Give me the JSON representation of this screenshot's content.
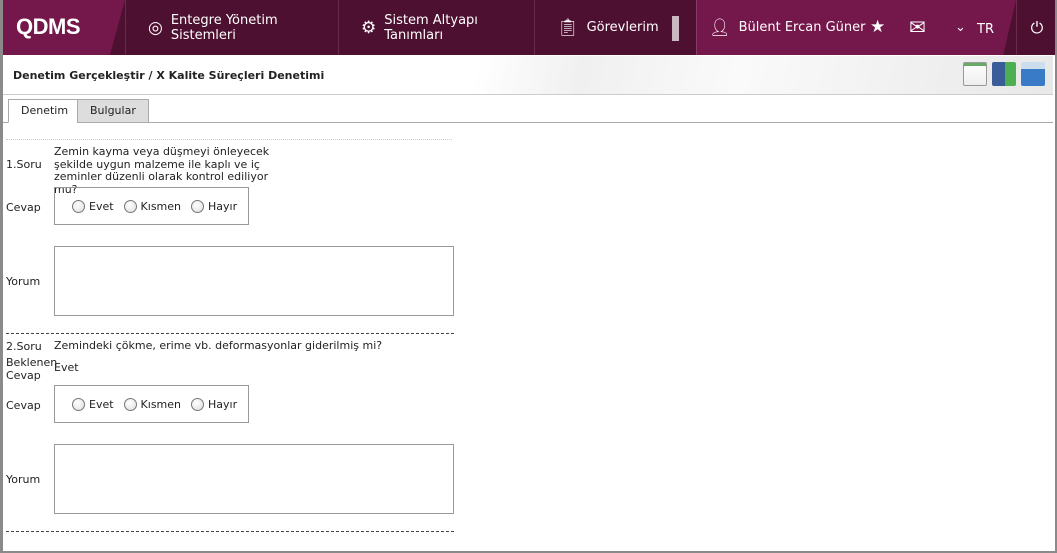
{
  "header": {
    "logo": "QDMS",
    "nav": [
      {
        "label": "Entegre Yönetim Sistemleri",
        "icon": "q-icon"
      },
      {
        "label": "Sistem Altyapı Tanımları",
        "icon": "gear-icon"
      },
      {
        "label": "Görevlerim",
        "icon": "clipboard-icon"
      }
    ],
    "user": "Bülent Ercan Güner",
    "language": "TR"
  },
  "breadcrumb": "Denetim Gerçekleştir / X Kalite Süreçleri Denetimi",
  "tabs": [
    "Denetim",
    "Bulgular"
  ],
  "labels": {
    "answer": "Cevap",
    "comment": "Yorum",
    "expected": "Beklenen Cevap"
  },
  "options": [
    "Evet",
    "Kısmen",
    "Hayır"
  ],
  "questions": [
    {
      "no": "1.Soru",
      "text": "Zemin kayma veya düşmeyi önleyecek şekilde uygun malzeme ile kaplı ve iç zeminler düzenli olarak kontrol ediliyor mu?"
    },
    {
      "no": "2.Soru",
      "text": "Zemindeki çökme, erime vb. deformasyonlar giderilmiş mi?",
      "expected": "Evet"
    }
  ]
}
